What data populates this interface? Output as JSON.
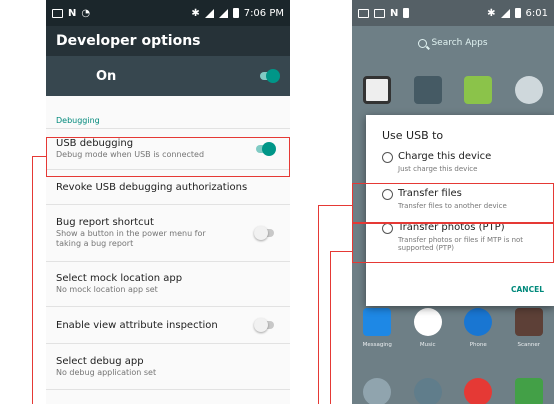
{
  "left_phone": {
    "status": {
      "time": "7:06 PM"
    },
    "app_bar": {
      "title": "Developer options"
    },
    "master_switch": {
      "label": "On",
      "checked": true
    },
    "section_header": "Debugging",
    "items": [
      {
        "title": "USB debugging",
        "summary": "Debug mode when USB is connected",
        "toggle": "on"
      },
      {
        "title": "Revoke USB debugging authorizations",
        "summary": "",
        "toggle": "none"
      },
      {
        "title": "Bug report shortcut",
        "summary": "Show a button in the power menu for taking a bug report",
        "toggle": "off"
      },
      {
        "title": "Select mock location app",
        "summary": "No mock location app set",
        "toggle": "none"
      },
      {
        "title": "Enable view attribute inspection",
        "summary": "",
        "toggle": "off"
      },
      {
        "title": "Select debug app",
        "summary": "No debug application set",
        "toggle": "none"
      }
    ]
  },
  "right_phone": {
    "status": {
      "time": "6:01"
    },
    "search": {
      "label": "Search Apps"
    },
    "bottom_apps": [
      "Messaging",
      "Music",
      "Phone",
      "Scanner"
    ],
    "dialog": {
      "title": "Use USB to",
      "options": [
        {
          "title": "Charge this device",
          "summary": "Just charge this device"
        },
        {
          "title": "Transfer files",
          "summary": "Transfer files to another device"
        },
        {
          "title": "Transfer photos (PTP)",
          "summary": "Transfer photos or files if MTP is not supported (PTP)"
        }
      ],
      "cancel_label": "CANCEL"
    }
  },
  "colors": {
    "accent": "#009688",
    "callout": "#e53935",
    "toolbar": "#263238",
    "switchbar": "#37474f"
  }
}
